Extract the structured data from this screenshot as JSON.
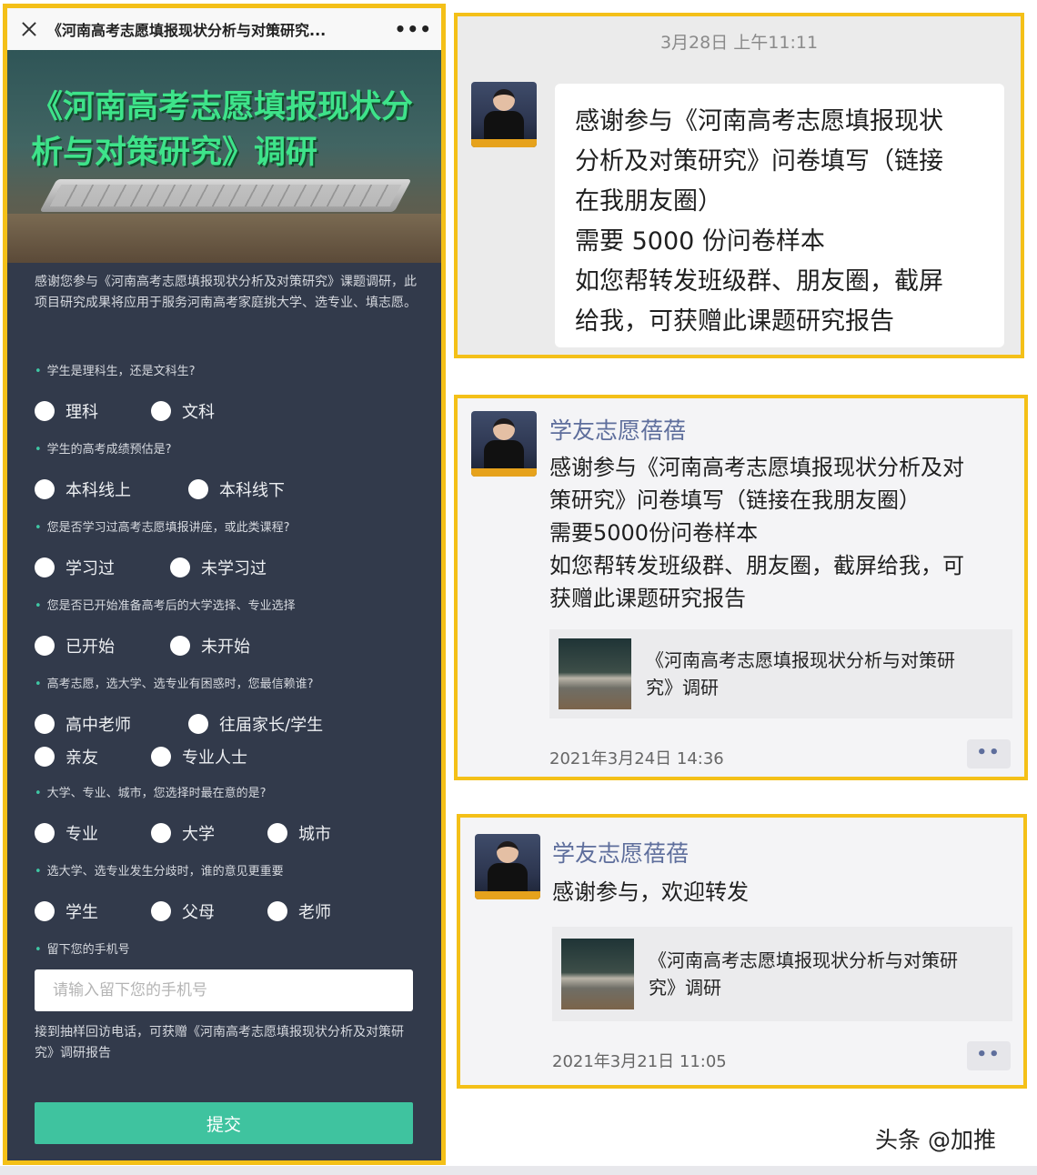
{
  "phone": {
    "header_title": "《河南高考志愿填报现状分析与对策研究...",
    "banner_title": "《河南高考志愿填报现状分析与对策研究》调研",
    "intro": "感谢您参与《河南高考志愿填报现状分析及对策研究》课题调研，此项目研究成果将应用于服务河南高考家庭挑大学、选专业、填志愿。",
    "questions": [
      {
        "label": "学生是理科生，还是文科生?",
        "options": [
          "理科",
          "文科"
        ]
      },
      {
        "label": "学生的高考成绩预估是?",
        "options": [
          "本科线上",
          "本科线下"
        ]
      },
      {
        "label": "您是否学习过高考志愿填报讲座，或此类课程?",
        "options": [
          "学习过",
          "未学习过"
        ]
      },
      {
        "label": "您是否已开始准备高考后的大学选择、专业选择",
        "options": [
          "已开始",
          "未开始"
        ]
      },
      {
        "label": "高考志愿，选大学、选专业有困惑时，您最信赖谁?",
        "options": [
          "高中老师",
          "往届家长/学生",
          "亲友",
          "专业人士"
        ]
      },
      {
        "label": "大学、专业、城市，您选择时最在意的是?",
        "options": [
          "专业",
          "大学",
          "城市"
        ]
      },
      {
        "label": "选大学、选专业发生分歧时，谁的意见更重要",
        "options": [
          "学生",
          "父母",
          "老师"
        ]
      },
      {
        "label": "留下您的手机号"
      }
    ],
    "phone_placeholder": "请输入留下您的手机号",
    "reward": "接到抽样回访电话，可获赠《河南高考志愿填报现状分析及对策研究》调研报告",
    "submit_label": "提交"
  },
  "chat": {
    "timestamp": "3月28日 上午11:11",
    "lines": [
      "感谢参与《河南高考志愿填报现状",
      "分析及对策研究》问卷填写（链接",
      "在我朋友圈）",
      "需要 5000 份问卷样本",
      "如您帮转发班级群、朋友圈，截屏",
      "给我，可获赠此课题研究报告"
    ]
  },
  "moment1": {
    "name": "学友志愿蓓蓓",
    "lines": [
      "感谢参与《河南高考志愿填报现状分析及对",
      "策研究》问卷填写（链接在我朋友圈）",
      "需要5000份问卷样本",
      "如您帮转发班级群、朋友圈，截屏给我，可",
      "获赠此课题研究报告"
    ],
    "link_lines": [
      "《河南高考志愿填报现状分析与对策研",
      "究》调研"
    ],
    "time": "2021年3月24日 14:36",
    "more": "••"
  },
  "moment2": {
    "name": "学友志愿蓓蓓",
    "text": "感谢参与，欢迎转发",
    "link_lines": [
      "《河南高考志愿填报现状分析与对策研",
      "究》调研"
    ],
    "time": "2021年3月21日 11:05",
    "more": "••"
  },
  "watermark": "头条 @加推"
}
